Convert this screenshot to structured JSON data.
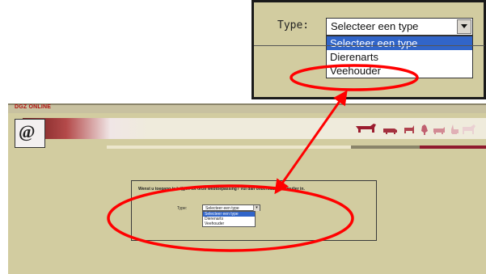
{
  "app": {
    "brand": "DGZ ONLINE"
  },
  "form": {
    "question": "Wenst u toegang te krijgen tot onze webtoepassing? Vul dan onderstaand formulier in.",
    "type_label": "Type:",
    "select_value": "Selecteer een type",
    "options": [
      "Selecteer een type",
      "Dierenarts",
      "Veehouder"
    ],
    "highlighted_option": "Selecteer een type",
    "circled_option": "Veehouder"
  },
  "colors": {
    "page_bg": "#d2cca0",
    "accent_red": "#b01010",
    "highlight_blue": "#3165c9",
    "annotation_red": "#ff0000"
  },
  "icons": {
    "dropdown": "chevron-down-icon",
    "logo": "at-logo-icon",
    "animals": "livestock-silhouettes-icon"
  }
}
